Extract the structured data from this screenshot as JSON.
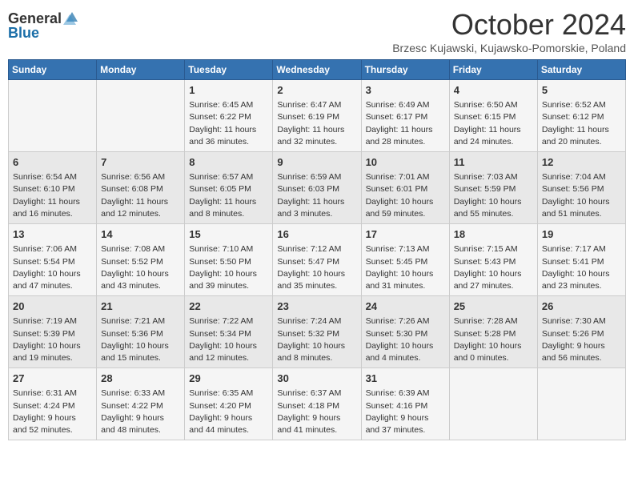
{
  "header": {
    "logo_general": "General",
    "logo_blue": "Blue",
    "month_title": "October 2024",
    "subtitle": "Brzesc Kujawski, Kujawsko-Pomorskie, Poland"
  },
  "weekdays": [
    "Sunday",
    "Monday",
    "Tuesday",
    "Wednesday",
    "Thursday",
    "Friday",
    "Saturday"
  ],
  "weeks": [
    [
      {
        "day": "",
        "info": ""
      },
      {
        "day": "",
        "info": ""
      },
      {
        "day": "1",
        "info": "Sunrise: 6:45 AM\nSunset: 6:22 PM\nDaylight: 11 hours\nand 36 minutes."
      },
      {
        "day": "2",
        "info": "Sunrise: 6:47 AM\nSunset: 6:19 PM\nDaylight: 11 hours\nand 32 minutes."
      },
      {
        "day": "3",
        "info": "Sunrise: 6:49 AM\nSunset: 6:17 PM\nDaylight: 11 hours\nand 28 minutes."
      },
      {
        "day": "4",
        "info": "Sunrise: 6:50 AM\nSunset: 6:15 PM\nDaylight: 11 hours\nand 24 minutes."
      },
      {
        "day": "5",
        "info": "Sunrise: 6:52 AM\nSunset: 6:12 PM\nDaylight: 11 hours\nand 20 minutes."
      }
    ],
    [
      {
        "day": "6",
        "info": "Sunrise: 6:54 AM\nSunset: 6:10 PM\nDaylight: 11 hours\nand 16 minutes."
      },
      {
        "day": "7",
        "info": "Sunrise: 6:56 AM\nSunset: 6:08 PM\nDaylight: 11 hours\nand 12 minutes."
      },
      {
        "day": "8",
        "info": "Sunrise: 6:57 AM\nSunset: 6:05 PM\nDaylight: 11 hours\nand 8 minutes."
      },
      {
        "day": "9",
        "info": "Sunrise: 6:59 AM\nSunset: 6:03 PM\nDaylight: 11 hours\nand 3 minutes."
      },
      {
        "day": "10",
        "info": "Sunrise: 7:01 AM\nSunset: 6:01 PM\nDaylight: 10 hours\nand 59 minutes."
      },
      {
        "day": "11",
        "info": "Sunrise: 7:03 AM\nSunset: 5:59 PM\nDaylight: 10 hours\nand 55 minutes."
      },
      {
        "day": "12",
        "info": "Sunrise: 7:04 AM\nSunset: 5:56 PM\nDaylight: 10 hours\nand 51 minutes."
      }
    ],
    [
      {
        "day": "13",
        "info": "Sunrise: 7:06 AM\nSunset: 5:54 PM\nDaylight: 10 hours\nand 47 minutes."
      },
      {
        "day": "14",
        "info": "Sunrise: 7:08 AM\nSunset: 5:52 PM\nDaylight: 10 hours\nand 43 minutes."
      },
      {
        "day": "15",
        "info": "Sunrise: 7:10 AM\nSunset: 5:50 PM\nDaylight: 10 hours\nand 39 minutes."
      },
      {
        "day": "16",
        "info": "Sunrise: 7:12 AM\nSunset: 5:47 PM\nDaylight: 10 hours\nand 35 minutes."
      },
      {
        "day": "17",
        "info": "Sunrise: 7:13 AM\nSunset: 5:45 PM\nDaylight: 10 hours\nand 31 minutes."
      },
      {
        "day": "18",
        "info": "Sunrise: 7:15 AM\nSunset: 5:43 PM\nDaylight: 10 hours\nand 27 minutes."
      },
      {
        "day": "19",
        "info": "Sunrise: 7:17 AM\nSunset: 5:41 PM\nDaylight: 10 hours\nand 23 minutes."
      }
    ],
    [
      {
        "day": "20",
        "info": "Sunrise: 7:19 AM\nSunset: 5:39 PM\nDaylight: 10 hours\nand 19 minutes."
      },
      {
        "day": "21",
        "info": "Sunrise: 7:21 AM\nSunset: 5:36 PM\nDaylight: 10 hours\nand 15 minutes."
      },
      {
        "day": "22",
        "info": "Sunrise: 7:22 AM\nSunset: 5:34 PM\nDaylight: 10 hours\nand 12 minutes."
      },
      {
        "day": "23",
        "info": "Sunrise: 7:24 AM\nSunset: 5:32 PM\nDaylight: 10 hours\nand 8 minutes."
      },
      {
        "day": "24",
        "info": "Sunrise: 7:26 AM\nSunset: 5:30 PM\nDaylight: 10 hours\nand 4 minutes."
      },
      {
        "day": "25",
        "info": "Sunrise: 7:28 AM\nSunset: 5:28 PM\nDaylight: 10 hours\nand 0 minutes."
      },
      {
        "day": "26",
        "info": "Sunrise: 7:30 AM\nSunset: 5:26 PM\nDaylight: 9 hours\nand 56 minutes."
      }
    ],
    [
      {
        "day": "27",
        "info": "Sunrise: 6:31 AM\nSunset: 4:24 PM\nDaylight: 9 hours\nand 52 minutes."
      },
      {
        "day": "28",
        "info": "Sunrise: 6:33 AM\nSunset: 4:22 PM\nDaylight: 9 hours\nand 48 minutes."
      },
      {
        "day": "29",
        "info": "Sunrise: 6:35 AM\nSunset: 4:20 PM\nDaylight: 9 hours\nand 44 minutes."
      },
      {
        "day": "30",
        "info": "Sunrise: 6:37 AM\nSunset: 4:18 PM\nDaylight: 9 hours\nand 41 minutes."
      },
      {
        "day": "31",
        "info": "Sunrise: 6:39 AM\nSunset: 4:16 PM\nDaylight: 9 hours\nand 37 minutes."
      },
      {
        "day": "",
        "info": ""
      },
      {
        "day": "",
        "info": ""
      }
    ]
  ]
}
